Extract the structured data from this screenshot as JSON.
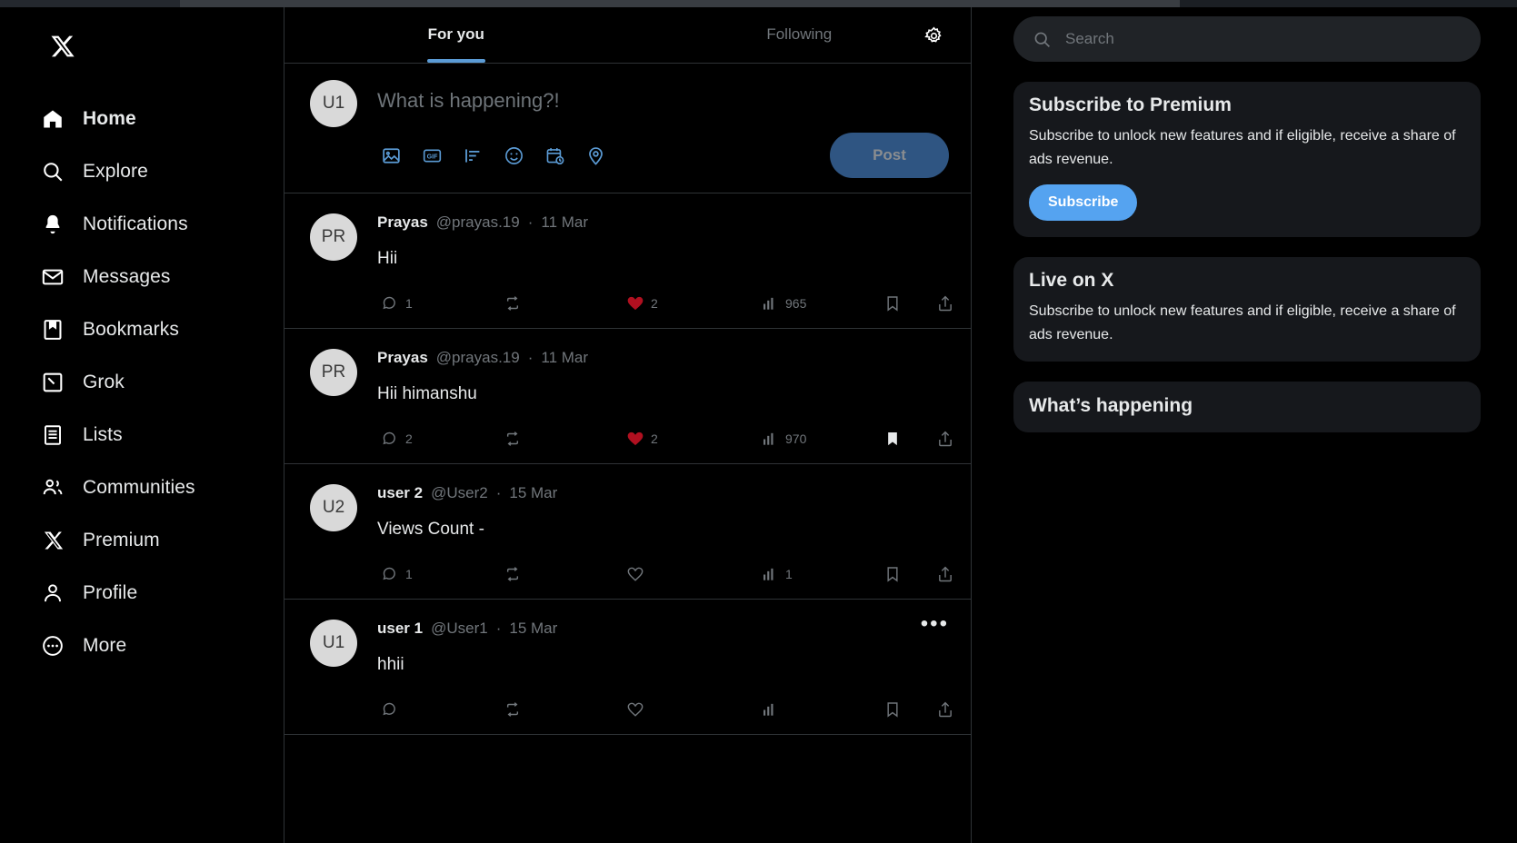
{
  "app": {
    "brand": "X"
  },
  "sidebar": {
    "logo_name": "x-logo",
    "items": [
      {
        "label": "Home",
        "icon": "home-icon",
        "active": true
      },
      {
        "label": "Explore",
        "icon": "search-icon",
        "active": false
      },
      {
        "label": "Notifications",
        "icon": "bell-icon",
        "active": false
      },
      {
        "label": "Messages",
        "icon": "envelope-icon",
        "active": false
      },
      {
        "label": "Bookmarks",
        "icon": "bookmark-icon",
        "active": false
      },
      {
        "label": "Grok",
        "icon": "grok-icon",
        "active": false
      },
      {
        "label": "Lists",
        "icon": "list-icon",
        "active": false
      },
      {
        "label": "Communities",
        "icon": "communities-icon",
        "active": false
      },
      {
        "label": "Premium",
        "icon": "x-badge-icon",
        "active": false
      },
      {
        "label": "Profile",
        "icon": "person-icon",
        "active": false
      },
      {
        "label": "More",
        "icon": "more-circle-icon",
        "active": false
      }
    ]
  },
  "feed": {
    "tabs": [
      {
        "label": "For you",
        "active": true
      },
      {
        "label": "Following",
        "active": false
      }
    ],
    "settings_icon": "gear-icon",
    "composer": {
      "avatar_initials": "U1",
      "placeholder": "What is happening?!",
      "post_label": "Post",
      "icons": [
        "image-icon",
        "gif-icon",
        "poll-icon",
        "emoji-icon",
        "schedule-icon",
        "location-icon"
      ]
    },
    "posts": [
      {
        "avatar_initials": "PR",
        "name": "Prayas",
        "handle": "@prayas.19",
        "separator": "·",
        "date": "11 Mar",
        "text": "Hii",
        "replies": "1",
        "reposts": "",
        "likes": "2",
        "views": "965",
        "liked": true,
        "bookmarked": false,
        "has_more_menu": false
      },
      {
        "avatar_initials": "PR",
        "name": "Prayas",
        "handle": "@prayas.19",
        "separator": "·",
        "date": "11 Mar",
        "text": "Hii himanshu",
        "replies": "2",
        "reposts": "",
        "likes": "2",
        "views": "970",
        "liked": true,
        "bookmarked": true,
        "has_more_menu": false
      },
      {
        "avatar_initials": "U2",
        "name": "user 2",
        "handle": "@User2",
        "separator": "·",
        "date": "15 Mar",
        "text": "Views Count -",
        "replies": "1",
        "reposts": "",
        "likes": "",
        "views": "1",
        "liked": false,
        "bookmarked": false,
        "has_more_menu": false
      },
      {
        "avatar_initials": "U1",
        "name": "user 1",
        "handle": "@User1",
        "separator": "·",
        "date": "15 Mar",
        "text": "hhii",
        "replies": "",
        "reposts": "",
        "likes": "",
        "views": "",
        "liked": false,
        "bookmarked": false,
        "has_more_menu": true,
        "more_label": "•••"
      }
    ]
  },
  "rightbar": {
    "search": {
      "placeholder": "Search",
      "icon": "search-icon",
      "value": ""
    },
    "cards": [
      {
        "title": "Subscribe to Premium",
        "body": "Subscribe to unlock new features and if eligible, receive a share of ads revenue.",
        "button": "Subscribe"
      },
      {
        "title": "Live on X",
        "body": "Subscribe to unlock new features and if eligible, receive a share of ads revenue.",
        "button": ""
      },
      {
        "title": "What’s happening",
        "body": "",
        "button": ""
      }
    ]
  },
  "colors": {
    "background": "#000000",
    "panel": "#16181c",
    "border": "#2f3336",
    "accent_blue": "#55a3f0",
    "tab_underline": "#5b9bd5",
    "muted_text": "#71767b",
    "like_red": "#b01020",
    "post_button": "#2f5582"
  }
}
